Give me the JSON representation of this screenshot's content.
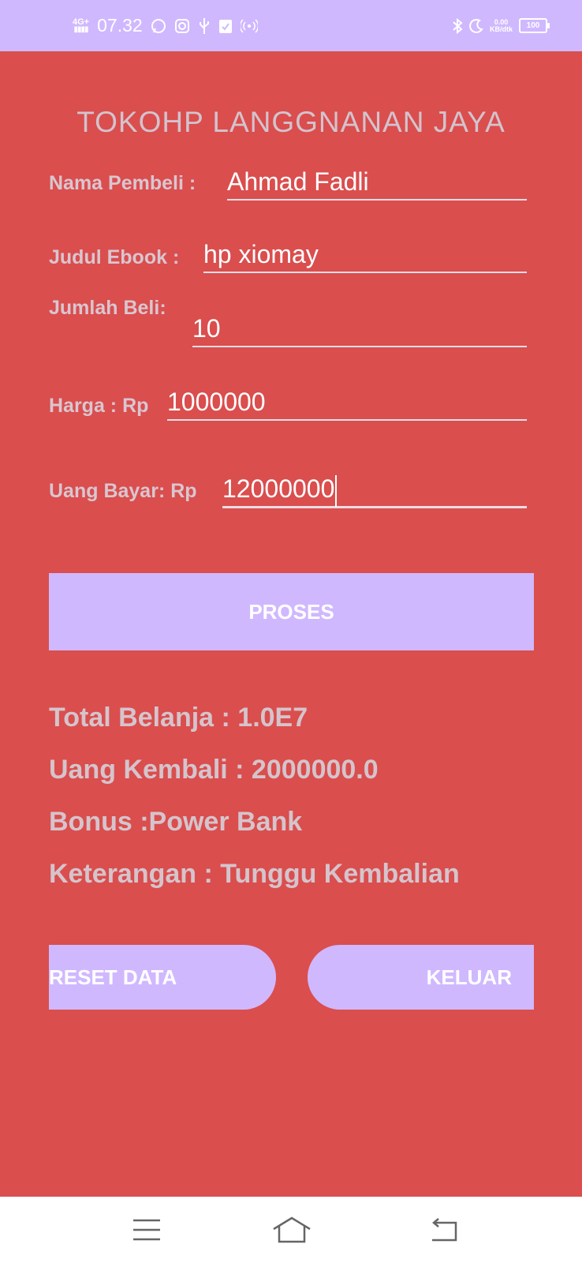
{
  "status_bar": {
    "network": "4G+",
    "time": "07.32",
    "speed_value": "0.00",
    "speed_unit": "KB/dtk",
    "battery": "100"
  },
  "app": {
    "title": "TOKOHP LANGGNANAN JAYA"
  },
  "form": {
    "nama_label": "Nama Pembeli :",
    "nama_value": "Ahmad Fadli",
    "judul_label": "Judul Ebook :",
    "judul_value": "hp xiomay",
    "jumlah_label": "Jumlah Beli:",
    "jumlah_value": "10",
    "harga_label": "Harga : Rp",
    "harga_value": "1000000",
    "bayar_label": "Uang Bayar: Rp",
    "bayar_value": "12000000"
  },
  "buttons": {
    "proses": "PROSES",
    "reset": "RESET DATA",
    "keluar": "KELUAR"
  },
  "results": {
    "total": "Total Belanja : 1.0E7",
    "kembali": "Uang Kembali : 2000000.0",
    "bonus": "Bonus :Power Bank",
    "keterangan": "Keterangan : Tunggu Kembalian"
  },
  "colors": {
    "background": "#da4e4e",
    "accent": "#d0b8ff",
    "navbar": "#ffffff"
  },
  "icons": {
    "status_left": [
      "whatsapp-icon",
      "instagram-icon",
      "usb-icon",
      "clipboard-check-icon",
      "hotspot-icon"
    ],
    "status_right": [
      "bluetooth-icon",
      "moon-icon",
      "battery-icon"
    ],
    "nav": [
      "menu-icon",
      "home-icon",
      "back-icon"
    ]
  }
}
